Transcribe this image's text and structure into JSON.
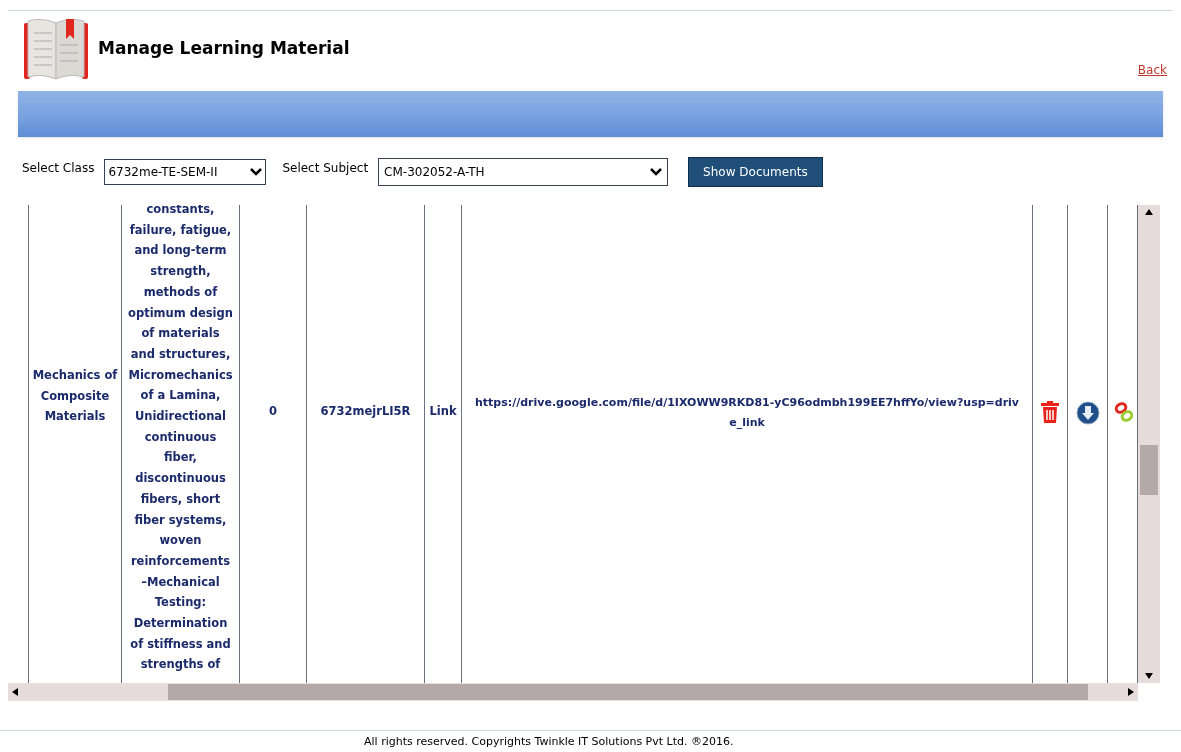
{
  "header": {
    "title": "Manage Learning Material",
    "back_link": "Back"
  },
  "filters": {
    "class_label": "Select Class",
    "class_value": "6732me-TE-SEM-II",
    "subject_label": "Select Subject",
    "subject_value": "CM-302052-A-TH",
    "button": "Show Documents"
  },
  "table": {
    "rows": [
      {
        "cells": [
          {
            "kind": "text",
            "text": "Mechanics of Composite Materials"
          },
          {
            "kind": "text",
            "text": "constants, failure, fatigue, and long-term strength, methods of optimum design of materials and structures, Micromechanics of a Lamina, Unidirectional continuous fiber, discontinuous fibers, short fiber systems, woven reinforcements –Mechanical Testing: Determination of stiffness and strengths of"
          },
          {
            "kind": "text",
            "text": "0"
          },
          {
            "kind": "text",
            "text": "6732mejrLI5R"
          },
          {
            "kind": "text",
            "text": "Link"
          },
          {
            "kind": "url",
            "text": "https://drive.google.com/file/d/1IXOWW9RKD81-yC96odmbh199EE7hffYo/view?usp=drive_link"
          },
          {
            "kind": "delete"
          },
          {
            "kind": "download"
          },
          {
            "kind": "link"
          }
        ]
      }
    ]
  },
  "footer": "All rights reserved. Copyrights Twinkle IT Solutions Pvt Ltd. ®2016."
}
